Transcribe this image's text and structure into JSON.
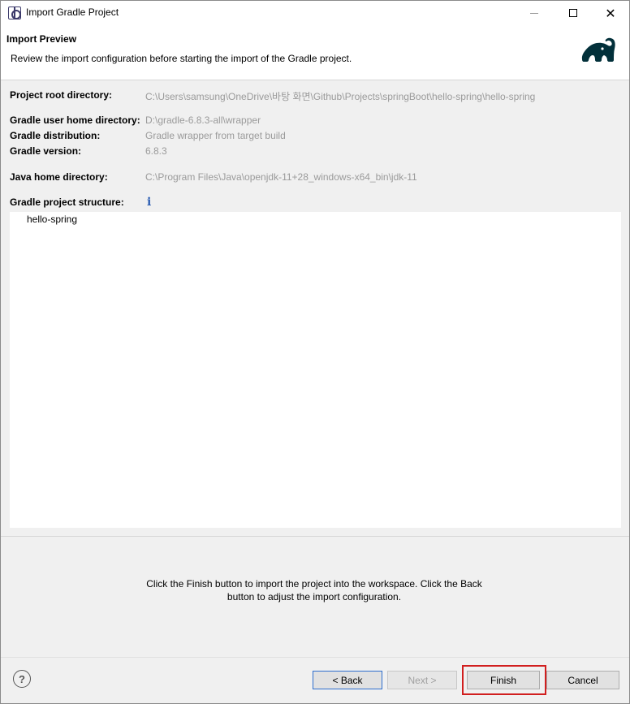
{
  "window": {
    "title": "Import Gradle Project"
  },
  "banner": {
    "title": "Import Preview",
    "description": "Review the import configuration before starting the import of the Gradle project."
  },
  "form": {
    "project_root_label": "Project root directory:",
    "project_root_value": "C:\\Users\\samsung\\OneDrive\\바탕 화면\\Github\\Projects\\springBoot\\hello-spring\\hello-spring",
    "gradle_home_label": "Gradle user home directory:",
    "gradle_home_value": "D:\\gradle-6.8.3-all\\wrapper",
    "gradle_dist_label": "Gradle distribution:",
    "gradle_dist_value": "Gradle wrapper from target build",
    "gradle_version_label": "Gradle version:",
    "gradle_version_value": "6.8.3",
    "java_home_label": "Java home directory:",
    "java_home_value": "C:\\Program Files\\Java\\openjdk-11+28_windows-x64_bin\\jdk-11",
    "structure_label": "Gradle project structure:"
  },
  "tree": {
    "items": [
      "hello-spring"
    ]
  },
  "message": "Click the Finish button to import the project into the workspace. Click the Back button to adjust the import configuration.",
  "buttons": {
    "back": "< Back",
    "next": "Next >",
    "finish": "Finish",
    "cancel": "Cancel",
    "help": "?"
  },
  "colors": {
    "highlight": "#d11f1f",
    "gradle_logo": "#02303a"
  }
}
